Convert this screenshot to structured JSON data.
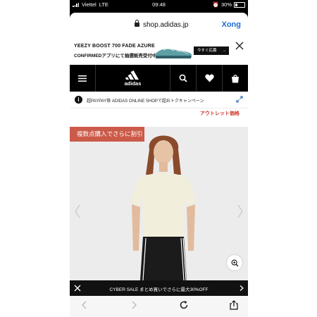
{
  "status_bar": {
    "carrier": "Viettel",
    "network": "LTE",
    "time": "09:48",
    "battery": "30%"
  },
  "browser": {
    "url": "shop.adidas.jp",
    "extension_label": "Xong"
  },
  "promo_banner": {
    "line1": "YEEZY BOOST 700 FADE AZURE",
    "line2": "CONFIRMEDアプリにて抽選販売受付中",
    "cta_label": "今すぐ応募",
    "cta_arrow": "→"
  },
  "header": {
    "logo_text": "adidas"
  },
  "notice": {
    "icon_glyph": "i",
    "text": "超PAYPAY祭 ADIDAS ONLINE SHOPで超おトクキャンペーン"
  },
  "outlet_label": "アウトレット価格",
  "hero": {
    "badge": "複数点購入でさらに割引"
  },
  "cyber_sale": {
    "text": "CYBER SALE まとめ買いでさらに最大30%OFF"
  },
  "colors": {
    "badge": "#cb5a49",
    "outlet_text": "#d0352a",
    "link_blue": "#1a6ed8",
    "header_bg": "#000000"
  }
}
